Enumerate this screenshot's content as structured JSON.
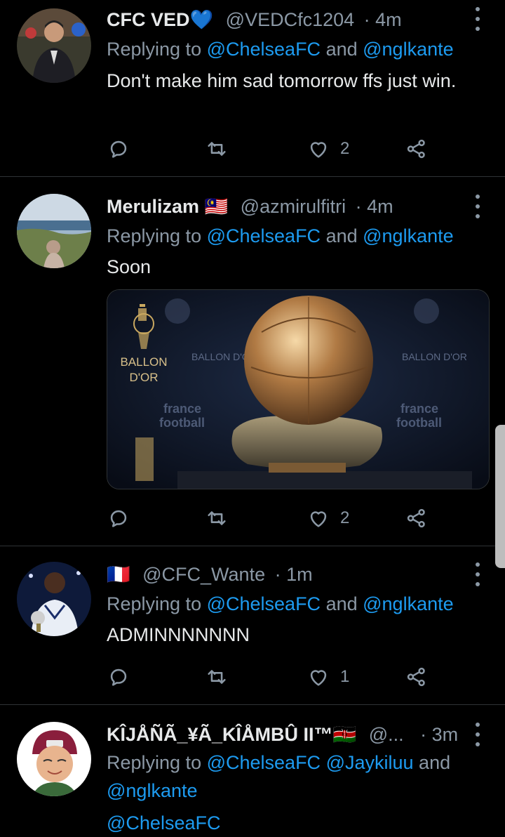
{
  "colors": {
    "background": "#000000",
    "text": "#e7e9ea",
    "muted": "#8b98a5",
    "link": "#1d9bf0",
    "divider": "#2f3336"
  },
  "tweets": [
    {
      "name": "CFC VED💙",
      "handle": "@VEDCfc1204",
      "time": "· 4m",
      "replying_prefix": "Replying to ",
      "mentions": [
        "@ChelseaFC",
        "@nglkante"
      ],
      "connector": " and ",
      "text": "Don't make him sad tomorrow ffs just win.",
      "likes": "2"
    },
    {
      "name": "Merulizam 🇲🇾",
      "handle": "@azmirulfitri",
      "time": "· 4m",
      "replying_prefix": "Replying to ",
      "mentions": [
        "@ChelseaFC",
        "@nglkante"
      ],
      "connector": " and ",
      "text": "Soon",
      "likes": "2",
      "media": {
        "logo_text_1": "BALLON",
        "logo_text_2": "D'OR",
        "banner_text": "BALLON D'OR",
        "sign_text_1": "france",
        "sign_text_2": "football"
      }
    },
    {
      "name": "🇫🇷",
      "handle": "@CFC_Wante",
      "time": "· 1m",
      "replying_prefix": "Replying to ",
      "mentions": [
        "@ChelseaFC",
        "@nglkante"
      ],
      "connector": " and ",
      "text": "ADMINNNNNNN",
      "likes": "1"
    },
    {
      "name": "KÎJÅÑÃ_¥Ã_KÎÅMBÛ II™🇰🇪",
      "handle": "@...",
      "time": "· 3m",
      "replying_prefix": "Replying to ",
      "mentions": [
        "@ChelseaFC",
        "@Jaykiluu",
        "@nglkante"
      ],
      "connector": " and ",
      "text": "@ChelseaFC"
    }
  ],
  "icons": [
    "reply-icon",
    "retweet-icon",
    "like-icon",
    "share-icon",
    "more-icon"
  ]
}
